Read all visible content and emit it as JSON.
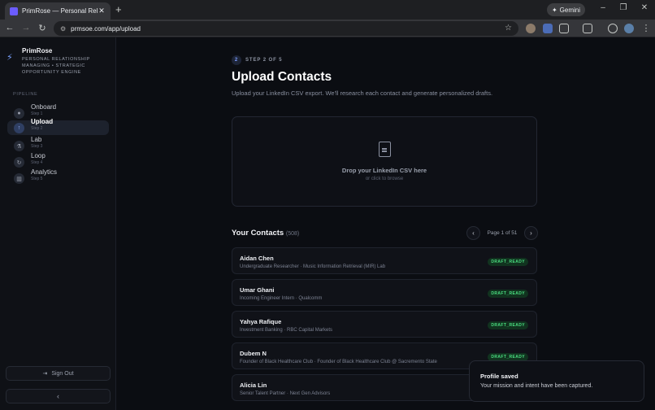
{
  "browser": {
    "tab_title": "PrimRose — Personal Relationship",
    "url": "prmsoe.com/app/upload",
    "gemini_label": "Gemini",
    "ext_badge": "9"
  },
  "brand": {
    "name": "PrimRose",
    "tagline": "PERSONAL RELATIONSHIP MANAGING • STRATEGIC OPPORTUNITY ENGINE"
  },
  "sidebar": {
    "section_label": "PIPELINE",
    "items": [
      {
        "label": "Onboard",
        "sub": "Step 1",
        "icon": "user-icon"
      },
      {
        "label": "Upload",
        "sub": "Step 2",
        "icon": "upload-icon"
      },
      {
        "label": "Lab",
        "sub": "Step 3",
        "icon": "flask-icon"
      },
      {
        "label": "Loop",
        "sub": "Step 4",
        "icon": "refresh-icon"
      },
      {
        "label": "Analytics",
        "sub": "Step 5",
        "icon": "bar-chart-icon"
      }
    ],
    "sign_out_label": "Sign Out",
    "collapse_glyph": "‹"
  },
  "main": {
    "step_number": "2",
    "step_label": "STEP 2 OF 5",
    "title": "Upload Contacts",
    "subtitle": "Upload your LinkedIn CSV export. We'll research each contact and generate personalized drafts.",
    "dropzone": {
      "title": "Drop your LinkedIn CSV here",
      "hint": "or click to browse"
    },
    "contacts": {
      "heading": "Your Contacts",
      "count": "(508)",
      "page_label": "Page 1 of 51",
      "rows": [
        {
          "name": "Aidan Chen",
          "desc": "Undergraduate Researcher · Music Information Retrieval (MIR) Lab",
          "status": "DRAFT_READY"
        },
        {
          "name": "Umar Ghani",
          "desc": "Incoming Engineer Intern · Qualcomm",
          "status": "DRAFT_READY"
        },
        {
          "name": "Yahya Rafique",
          "desc": "Investment Banking · RBC Capital Markets",
          "status": "DRAFT_READY"
        },
        {
          "name": "Dubem N",
          "desc": "Founder of Black Healthcare Club · Founder of Black Healthcare Club @ Sacremento State",
          "status": "DRAFT_READY"
        },
        {
          "name": "Alicia Lin",
          "desc": "Senior Talent Partner · Next Gen Advisors",
          "status": ""
        }
      ]
    }
  },
  "toast": {
    "title": "Profile saved",
    "body": "Your mission and intent have been captured."
  }
}
